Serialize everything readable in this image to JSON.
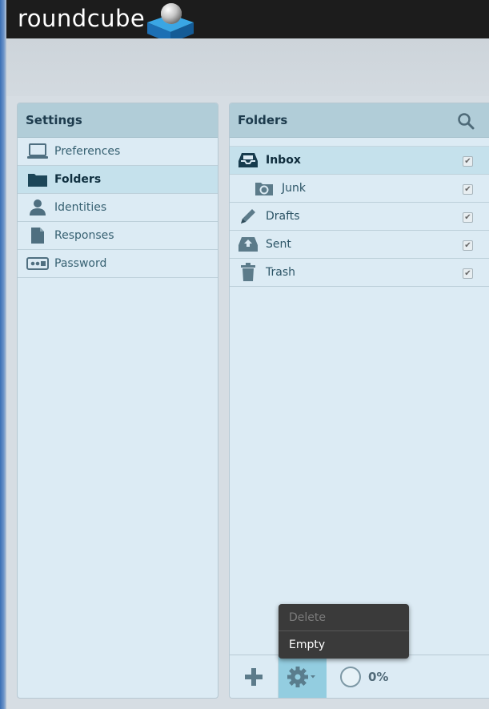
{
  "app": {
    "logo_text": "roundcube"
  },
  "settings": {
    "title": "Settings",
    "items": [
      {
        "label": "Preferences",
        "icon": "laptop-icon",
        "selected": false
      },
      {
        "label": "Folders",
        "icon": "folder-icon",
        "selected": true
      },
      {
        "label": "Identities",
        "icon": "person-icon",
        "selected": false
      },
      {
        "label": "Responses",
        "icon": "document-icon",
        "selected": false
      },
      {
        "label": "Password",
        "icon": "password-icon",
        "selected": false
      }
    ]
  },
  "folders": {
    "title": "Folders",
    "items": [
      {
        "label": "Inbox",
        "icon": "inbox-icon",
        "selected": true,
        "subscribed": true
      },
      {
        "label": "Junk",
        "icon": "junk-icon",
        "selected": false,
        "subscribed": true,
        "indent": 1
      },
      {
        "label": "Drafts",
        "icon": "pencil-icon",
        "selected": false,
        "subscribed": true
      },
      {
        "label": "Sent",
        "icon": "sent-icon",
        "selected": false,
        "subscribed": true
      },
      {
        "label": "Trash",
        "icon": "trash-icon",
        "selected": false,
        "subscribed": true
      }
    ],
    "quota": "0%"
  },
  "menu": {
    "items": [
      {
        "label": "Delete",
        "enabled": false
      },
      {
        "label": "Empty",
        "enabled": true
      }
    ]
  },
  "colors": {
    "header": "#b1cdd8",
    "selected_row": "#c5e1ec",
    "gear_active": "#93cde0",
    "topbar": "#1c1c1c"
  }
}
